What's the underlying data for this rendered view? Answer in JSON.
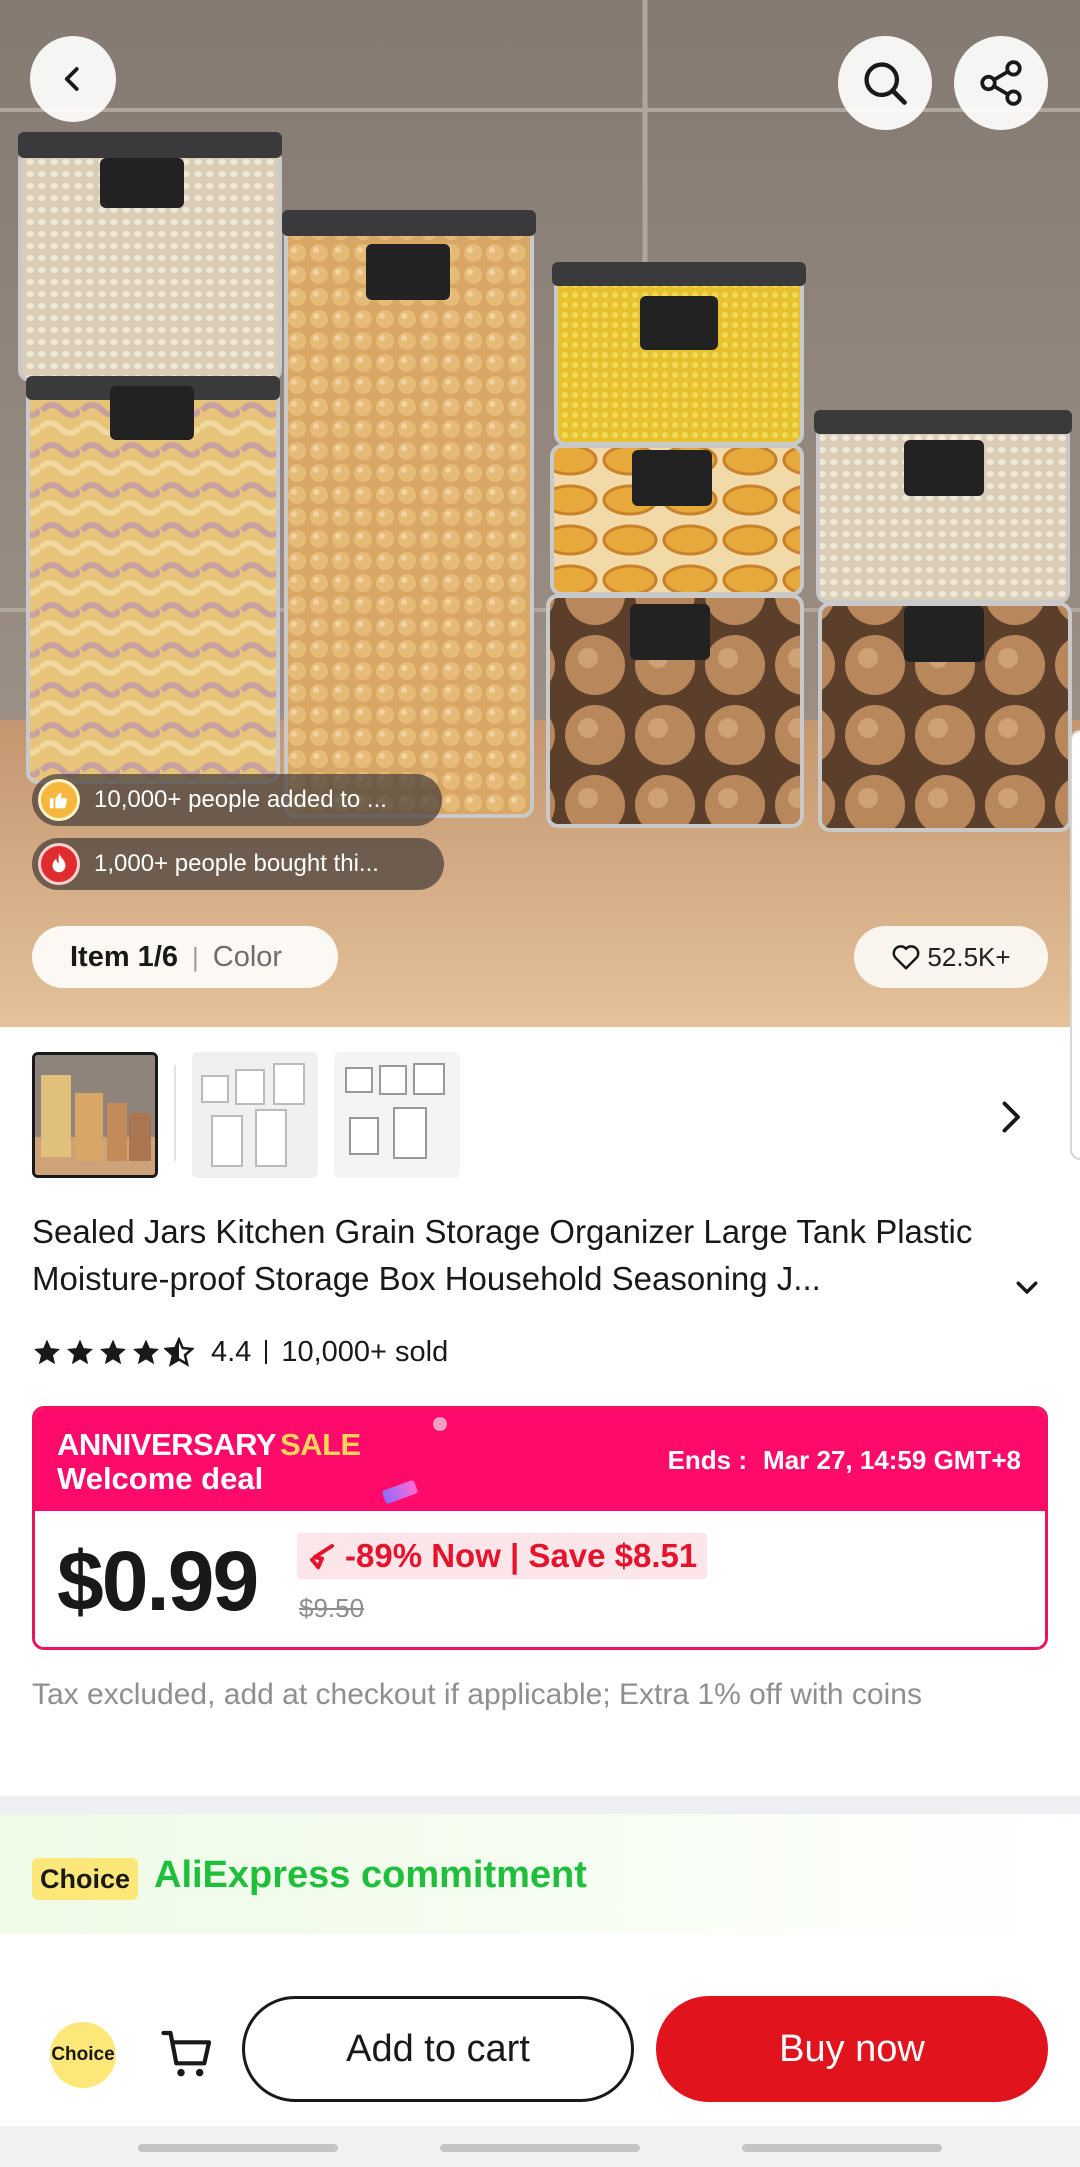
{
  "hero": {
    "social_added": "10,000+ people added to ...",
    "social_bought": "1,000+ people bought thi...",
    "item_index": "Item 1/6",
    "item_color": "Color",
    "wishlist_count": "52.5K+"
  },
  "product": {
    "title": "Sealed Jars Kitchen Grain Storage Organizer Large Tank Plastic Moisture-proof Storage Box Household Seasoning J...",
    "rating": "4.4",
    "sold": "10,000+ sold"
  },
  "sale": {
    "event_name": "ANNIVERSARY",
    "event_sale": "SALE",
    "subtitle": "Welcome deal",
    "ends_label": "Ends :",
    "ends_time": "Mar 27, 14:59 GMT+8",
    "price": "$0.99",
    "discount": "-89% Now | Save $8.51",
    "original_price": "$9.50"
  },
  "tax_note": "Tax excluded, add at checkout if applicable; Extra 1% off with coins",
  "choice": {
    "badge": "Choice",
    "title": "AliExpress commitment"
  },
  "bottom_bar": {
    "choice_label": "Choice",
    "add_to_cart": "Add to cart",
    "buy_now": "Buy now"
  },
  "colors": {
    "sale_pink": "#fd0a6b",
    "buy_red": "#e1141e",
    "choice_green": "#1dbf3b",
    "choice_yellow": "#fde779"
  }
}
